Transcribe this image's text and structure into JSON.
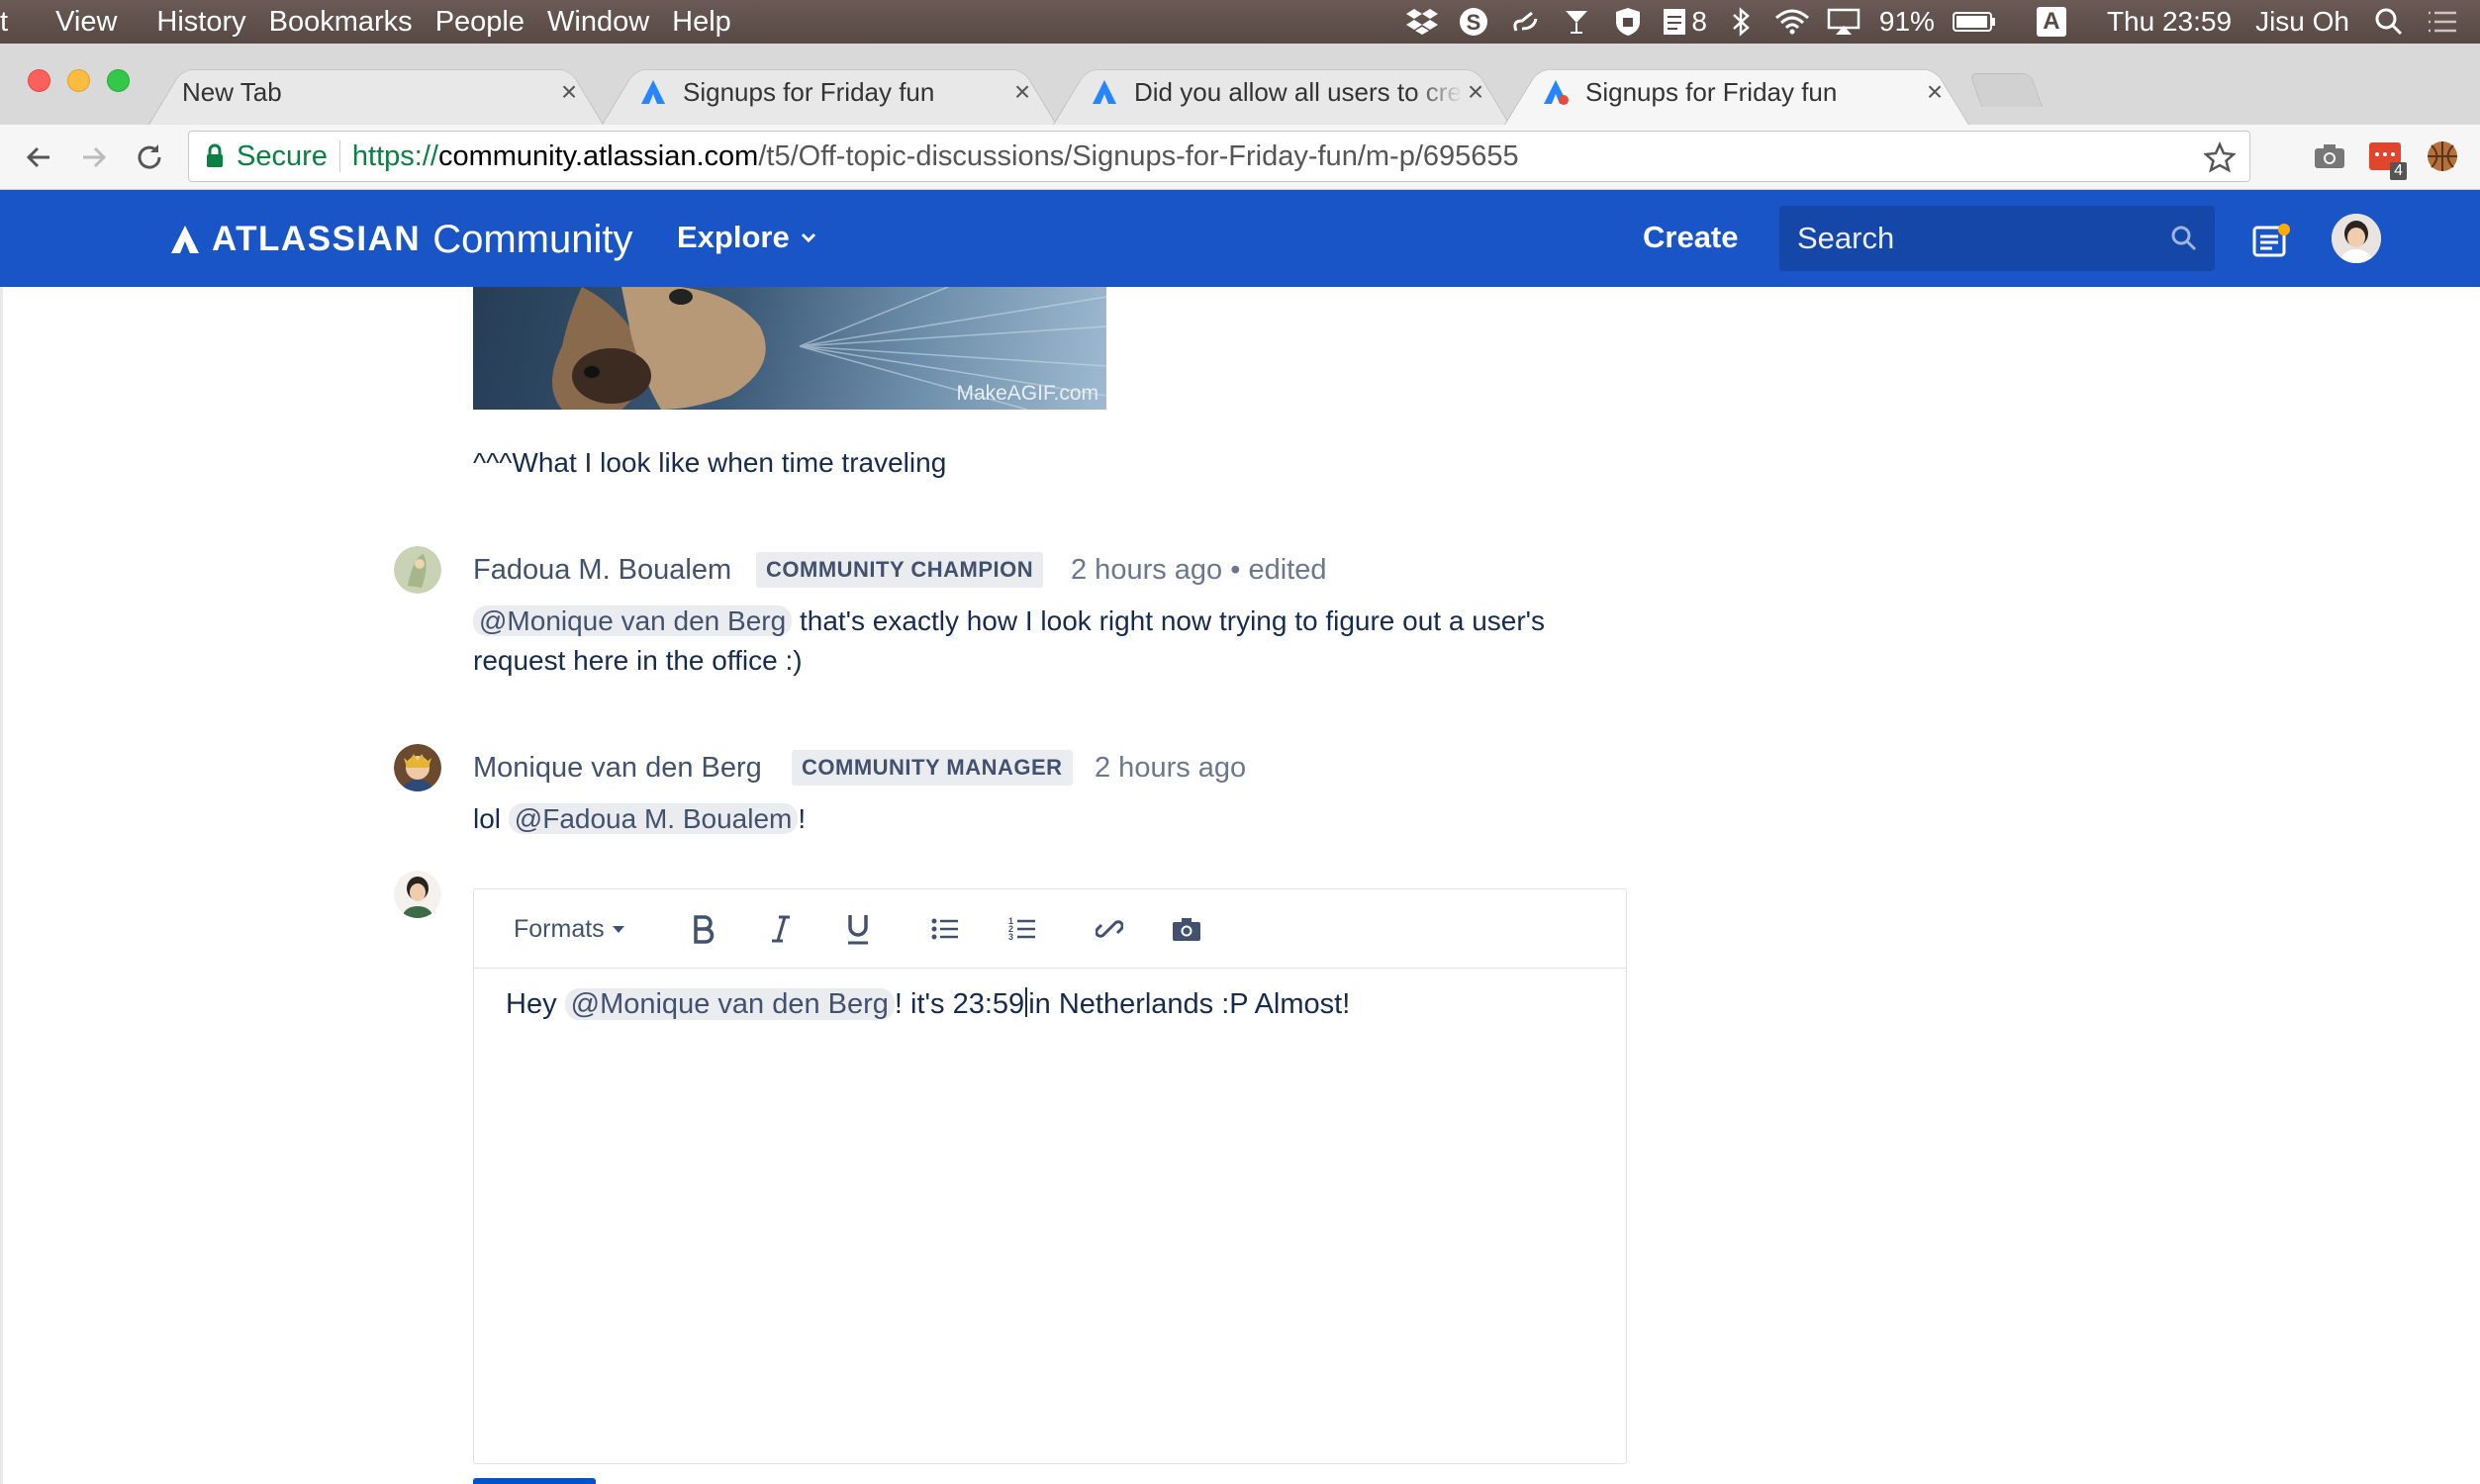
{
  "menubar": {
    "items": [
      "t",
      "View",
      "History",
      "Bookmarks",
      "People",
      "Window",
      "Help"
    ],
    "battery": "91%",
    "clock": "Thu 23:59",
    "user": "Jisu Oh",
    "badge_count": "8",
    "input_source": "A"
  },
  "tabs": [
    {
      "title": "New Tab",
      "active": false,
      "favicon": "none"
    },
    {
      "title": "Signups for Friday fun",
      "active": false,
      "favicon": "atlassian-icon"
    },
    {
      "title": "Did you allow all users to creat",
      "active": false,
      "favicon": "atlassian-icon"
    },
    {
      "title": "Signups for Friday fun",
      "active": true,
      "favicon": "atlassian-icon"
    }
  ],
  "address_bar": {
    "secure_label": "Secure",
    "url_scheme": "https://",
    "url_host": "community.atlassian.com",
    "url_path": "/t5/Off-topic-discussions/Signups-for-Friday-fun/m-p/695655",
    "extension_badge": "4"
  },
  "site_header": {
    "brand": "ATLASSIAN",
    "product": "Community",
    "explore_label": "Explore",
    "create_label": "Create",
    "search_placeholder": "Search",
    "brand_color": "#1a55c7"
  },
  "gif": {
    "watermark": "MakeAGIF.com"
  },
  "posts": [
    {
      "text": "^^^What I look like when time traveling"
    },
    {
      "author": "Fadoua M. Boualem",
      "badge": "COMMUNITY CHAMPION",
      "time": "2 hours ago",
      "edited": "• edited",
      "mention": "@Monique van den Berg",
      "line1": "that's exactly how I look right now trying to figure out a user's",
      "line2": "request here in the office :)"
    },
    {
      "author": "Monique van den Berg",
      "badge": "COMMUNITY MANAGER",
      "time": "2 hours ago",
      "prefix": "lol",
      "mention": "@Fadoua M. Boualem",
      "suffix": "!"
    }
  ],
  "editor": {
    "formats_label": "Formats",
    "tools": [
      "bold-icon",
      "italic-icon",
      "underline-icon",
      "bullet-list-icon",
      "numbered-list-icon",
      "link-icon",
      "camera-icon"
    ],
    "prefix": "Hey",
    "mention": "@Monique van den Berg",
    "text_before_caret": "! it's 23:59",
    "text_after_caret": "in Netherlands :P Almost!"
  }
}
